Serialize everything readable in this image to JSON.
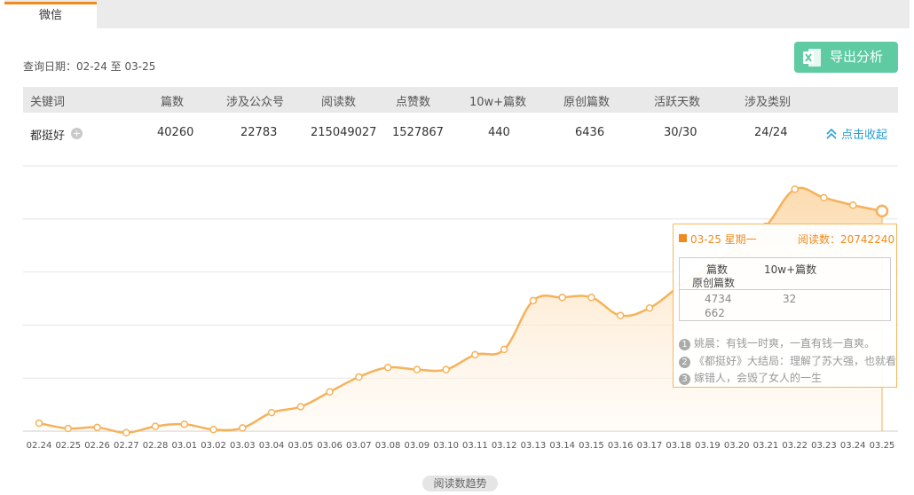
{
  "tab": {
    "label": "微信"
  },
  "query": {
    "text": "查询日期：02-24 至 03-25"
  },
  "export_button": {
    "label": "导出分析"
  },
  "table": {
    "headers": [
      "关键词",
      "篇数",
      "涉及公众号",
      "阅读数",
      "点赞数",
      "10w+篇数",
      "原创篇数",
      "活跃天数",
      "涉及类别"
    ],
    "row": [
      "都挺好",
      "40260",
      "22783",
      "215049027",
      "1527867",
      "440",
      "6436",
      "30/30",
      "24/24"
    ],
    "collapse_label": "点击收起"
  },
  "chart_data": {
    "type": "line",
    "categories": [
      "02.24",
      "02.25",
      "02.26",
      "02.27",
      "02.28",
      "03.01",
      "03.02",
      "03.03",
      "03.04",
      "03.05",
      "03.06",
      "03.07",
      "03.08",
      "03.09",
      "03.10",
      "03.11",
      "03.12",
      "03.13",
      "03.14",
      "03.15",
      "03.16",
      "03.17",
      "03.18",
      "03.19",
      "03.20",
      "03.21",
      "03.22",
      "03.23",
      "03.24",
      "03.25"
    ],
    "series": [
      {
        "name": "阅读数",
        "values": [
          750000,
          250000,
          350000,
          -150000,
          450000,
          650000,
          150000,
          300000,
          1750000,
          2300000,
          3700000,
          5100000,
          6000000,
          5800000,
          5800000,
          7200000,
          7700000,
          12300000,
          12600000,
          12600000,
          10900000,
          11600000,
          13600000,
          15400000,
          17300000,
          19300000,
          22800000,
          22000000,
          21300000,
          20742240
        ]
      }
    ],
    "line_color": "#f5b25b",
    "fill_color": "#fbd7a6",
    "legend": "阅读数趋势",
    "grid": true
  },
  "tooltip": {
    "date": "03-25  星期一",
    "reads": "阅读数：20742240",
    "headers": [
      "篇数",
      "10w+篇数",
      "原创篇数"
    ],
    "values": [
      "4734",
      "32",
      "662"
    ],
    "news": [
      "姚晨：有钱一时爽，一直有钱一直爽。",
      "《都挺好》大结局：理解了苏大强，也就看",
      "嫁错人，会毁了女人的一生"
    ]
  }
}
